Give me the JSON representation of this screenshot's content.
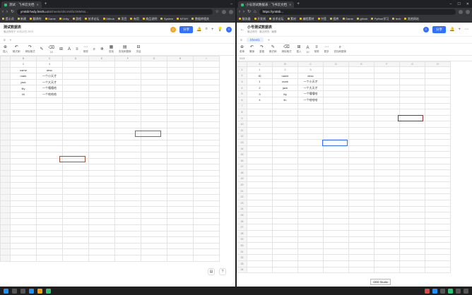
{
  "left": {
    "tab_title": "测试 · 飞书云文档",
    "url": "ym5tb7wdy.feishu.cn",
    "url_rest": "/sheets/shtcnWbIJWMNo...",
    "bookmarks": [
      "提示词",
      "新建",
      "翻译的",
      "Game",
      "Unity",
      "游戏",
      "技术论坛",
      "Github",
      "项目",
      "有用",
      "商品说明",
      "System",
      "NTWY",
      "数据库相关"
    ],
    "doc_title": "测试数据表",
    "doc_sub": "最近修改于 10月22日 2023",
    "share": "分享",
    "toolbar": [
      "插入",
      "格式刷",
      "清除格式",
      "",
      "10",
      "",
      "",
      "",
      "常规",
      "",
      "",
      "查找",
      "查找和替换",
      "冻结"
    ],
    "sheet_tab": "",
    "cols": [
      "B",
      "C",
      "D",
      "E",
      "F",
      "G",
      "H",
      "I"
    ],
    "rows": [
      [
        "2",
        "3",
        "",
        "",
        "",
        "",
        "",
        ""
      ],
      [
        "name",
        "desc",
        "",
        "",
        "",
        "",
        "",
        ""
      ],
      [
        "mark",
        "一个小天才",
        "",
        "",
        "",
        "",
        "",
        ""
      ],
      [
        "jack",
        "一个大天才",
        "",
        "",
        "",
        "",
        "",
        ""
      ],
      [
        "lily",
        "一个嘻嘻哈",
        "",
        "",
        "",
        "",
        "",
        ""
      ],
      [
        "lili",
        "一个哈哈哈",
        "",
        "",
        "",
        "",
        "",
        ""
      ]
    ]
  },
  "right": {
    "tab_title": "小号测试数据表 · 飞书云文档",
    "url": "https://yn55b...",
    "bookmarks": [
      "服务器",
      "开发线",
      "技术论坛",
      "素材",
      "编程素材",
      "书签",
      "图库",
      "Game",
      "github",
      "Python学习",
      "tech",
      "其他网站"
    ],
    "doc_title": "小号测试数据表",
    "doc_sub": "最近修改 · 最近修改 · 编辑",
    "share": "分享",
    "sheet_tab": "Sheet1",
    "cell_ref": "D13",
    "toolbar": [
      "菜单",
      "撤销",
      "重做",
      "格式刷",
      "清除格式",
      "插入",
      "10",
      "常规",
      "更多",
      "查找和替换"
    ],
    "cols": [
      "A",
      "B",
      "C",
      "D",
      "E",
      "F",
      "G",
      "H"
    ],
    "rows": [
      [
        "1",
        "2",
        "3",
        "",
        "",
        "",
        "",
        ""
      ],
      [
        "ID",
        "name",
        "desc",
        "",
        "",
        "",
        "",
        ""
      ],
      [
        "1",
        "mark",
        "一个小天才",
        "",
        "",
        "",
        "",
        ""
      ],
      [
        "2",
        "jack",
        "一个大天才",
        "",
        "",
        "",
        "",
        ""
      ],
      [
        "3",
        "lily",
        "一个嘻嘻哈",
        "",
        "",
        "",
        "",
        ""
      ],
      [
        "4",
        "lin",
        "一个哈哈哈",
        "",
        "",
        "",
        "",
        ""
      ]
    ],
    "row_numbers": [
      "1",
      "2",
      "3",
      "4",
      "5",
      "6",
      "7",
      "8",
      "9",
      "10",
      "11",
      "12",
      "13",
      "14",
      "15",
      "16",
      "17",
      "18",
      "19",
      "20",
      "21",
      "22",
      "23",
      "24",
      "25",
      "26",
      "27",
      "28",
      "29",
      "30",
      "31",
      "32",
      "33",
      "34"
    ]
  },
  "taskbar": {
    "tooltip": "OBS Studio",
    "time": "",
    "date": ""
  },
  "colors": {
    "accent": "#3370ff",
    "sel_blue": "#3370ff",
    "sel_brown": "#a0522d",
    "sel_darkred": "#8b2e2e"
  }
}
